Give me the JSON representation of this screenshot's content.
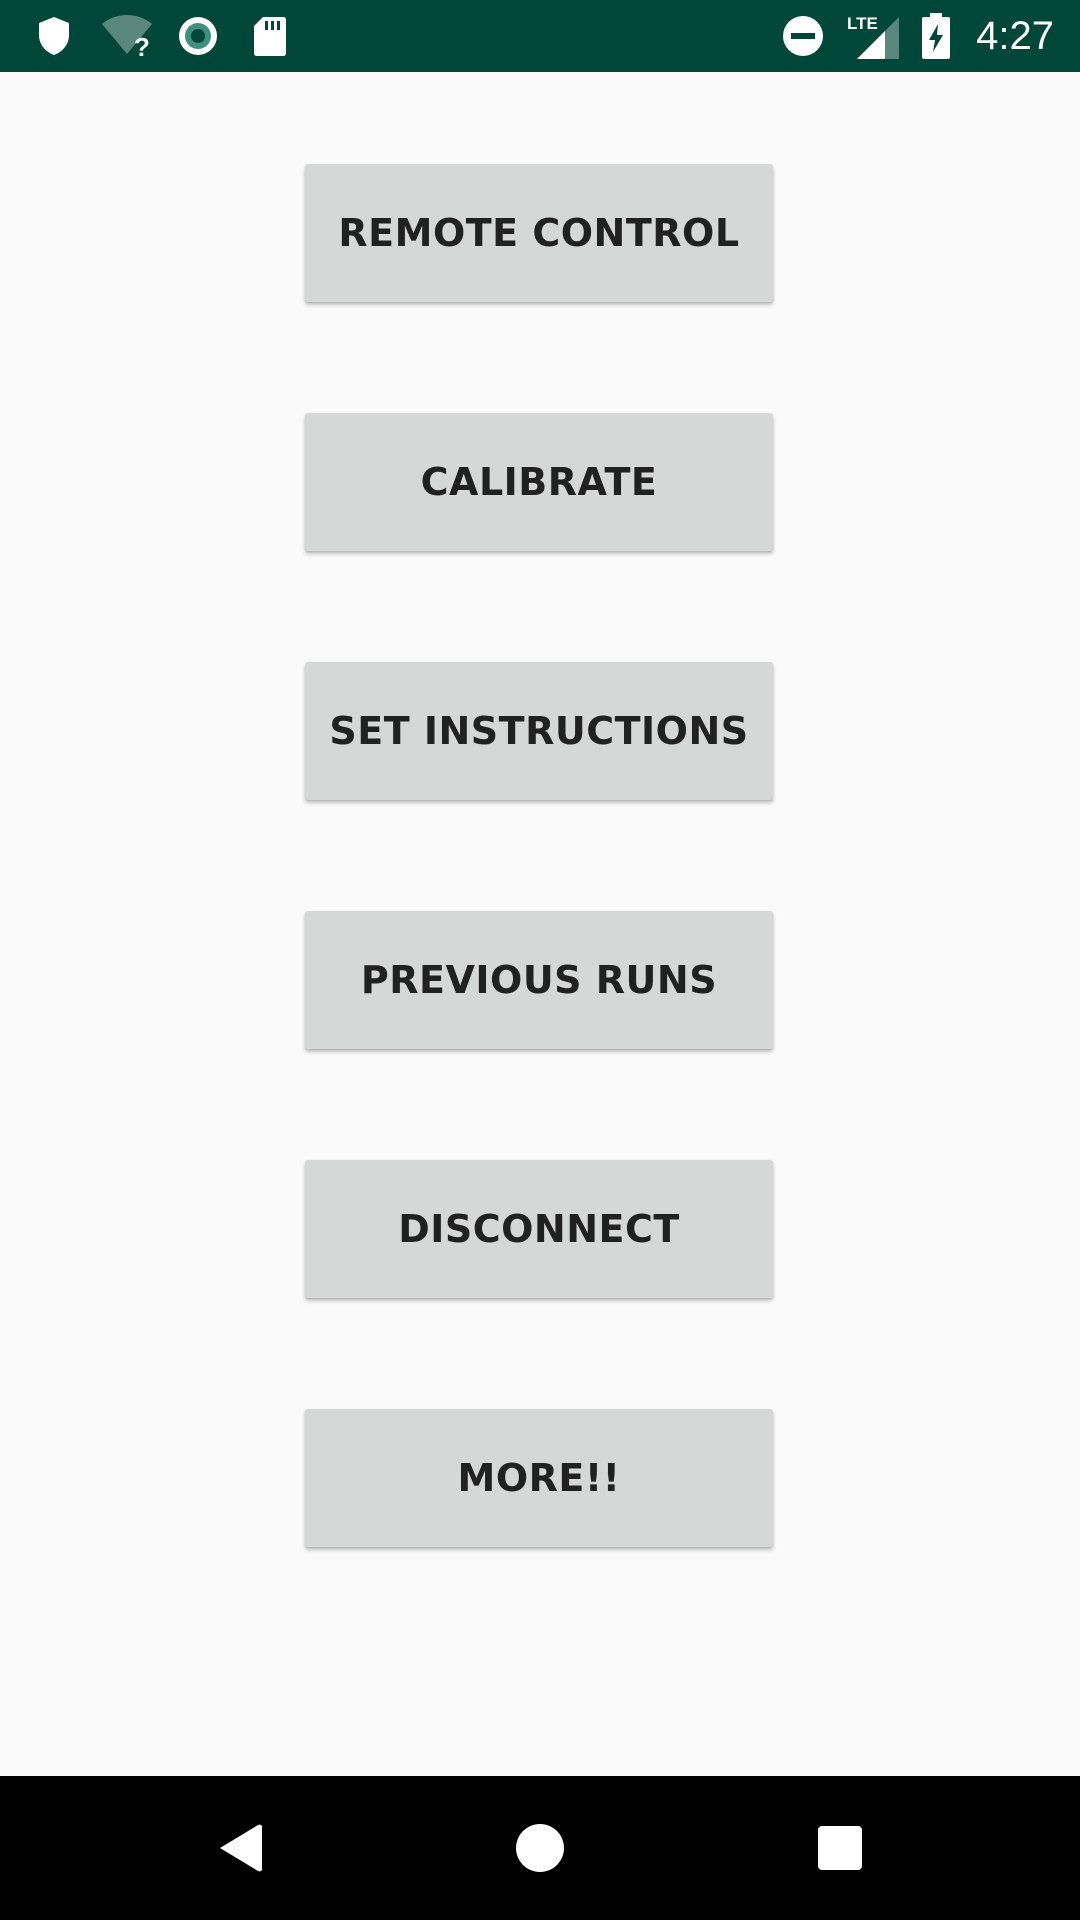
{
  "status_bar": {
    "time": "4:27",
    "network_label": "LTE",
    "icons": [
      "shield-icon",
      "wifi-unknown-icon",
      "sync-circle-icon",
      "sd-card-icon",
      "do-not-disturb-icon",
      "lte-signal-icon",
      "battery-charging-icon"
    ],
    "background_color": "#00473a"
  },
  "menu": {
    "buttons": [
      {
        "label": "REMOTE CONTROL"
      },
      {
        "label": "CALIBRATE"
      },
      {
        "label": "SET INSTRUCTIONS"
      },
      {
        "label": "PREVIOUS RUNS"
      },
      {
        "label": "DISCONNECT"
      },
      {
        "label": "MORE!!"
      }
    ],
    "button_color": "#d6d7d7",
    "text_color": "#212121"
  },
  "nav_bar": {
    "icons": [
      "back-icon",
      "home-icon",
      "recents-icon"
    ],
    "background_color": "#000000"
  }
}
